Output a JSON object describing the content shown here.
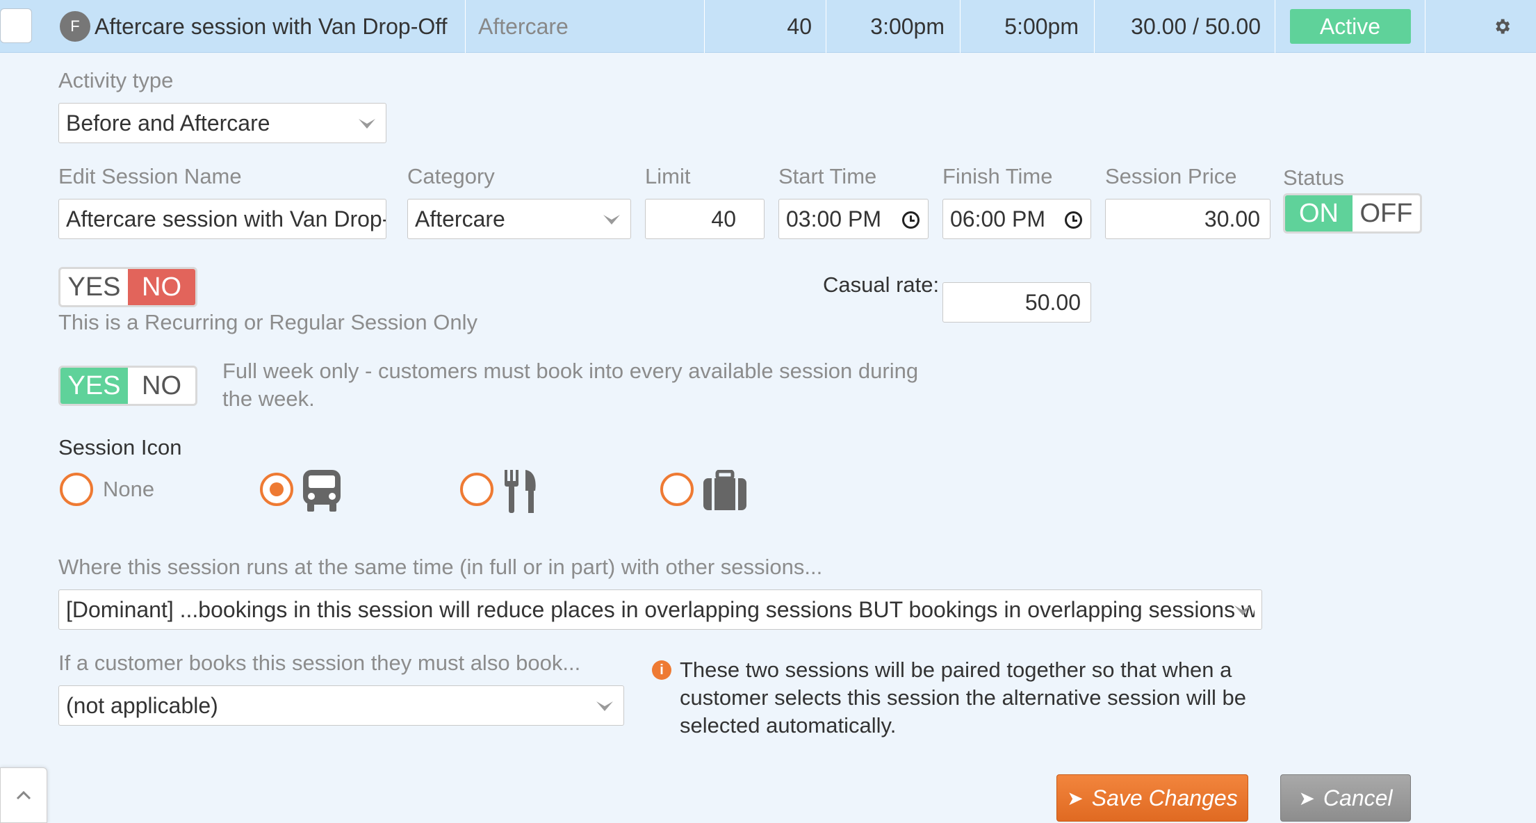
{
  "header": {
    "badge": "F",
    "session_name": "Aftercare session with Van Drop-Off",
    "category": "Aftercare",
    "limit": "40",
    "start_time": "3:00pm",
    "finish_time": "5:00pm",
    "price": "30.00 / 50.00",
    "status": "Active"
  },
  "form": {
    "activity_type": {
      "label": "Activity type",
      "value": "Before and Aftercare"
    },
    "session_name": {
      "label": "Edit Session Name",
      "value": "Aftercare session with Van Drop-"
    },
    "category": {
      "label": "Category",
      "value": "Aftercare"
    },
    "limit": {
      "label": "Limit",
      "value": "40"
    },
    "start_time": {
      "label": "Start Time",
      "value": "03:00 PM"
    },
    "finish_time": {
      "label": "Finish Time",
      "value": "06:00 PM"
    },
    "session_price": {
      "label": "Session Price",
      "value": "30.00"
    },
    "status": {
      "label": "Status",
      "on": "ON",
      "off": "OFF",
      "selected": "ON"
    },
    "recurring": {
      "yes": "YES",
      "no": "NO",
      "selected": "NO",
      "help": "This is a Recurring or Regular Session Only"
    },
    "casual_rate": {
      "label": "Casual rate:",
      "value": "50.00"
    },
    "full_week": {
      "yes": "YES",
      "no": "NO",
      "selected": "YES",
      "help": "Full week only - customers must book into every available session during the week."
    },
    "session_icon": {
      "label": "Session Icon",
      "options": [
        {
          "name": "none",
          "label": "None",
          "checked": false
        },
        {
          "name": "bus-icon",
          "checked": true
        },
        {
          "name": "cutlery-icon",
          "checked": false
        },
        {
          "name": "briefcase-icon",
          "checked": false
        }
      ]
    },
    "overlap": {
      "label": "Where this session runs at the same time (in full or in part) with other sessions...",
      "value": "[Dominant] ...bookings in this session will reduce places in overlapping sessions BUT bookings in overlapping sessions will NO"
    },
    "must_book": {
      "label": "If a customer books this session they must also book...",
      "value": "(not applicable)"
    },
    "pairing_info": "These two sessions will be paired together so that when a customer selects this session the alternative session will be selected automatically."
  },
  "actions": {
    "save": "Save Changes",
    "cancel": "Cancel"
  },
  "colors": {
    "header_bg": "#c6e2f8",
    "active_green": "#5fd29a",
    "no_red": "#e2645b",
    "accent_orange": "#ee7a33",
    "cancel_grey": "#9b9b9b"
  }
}
